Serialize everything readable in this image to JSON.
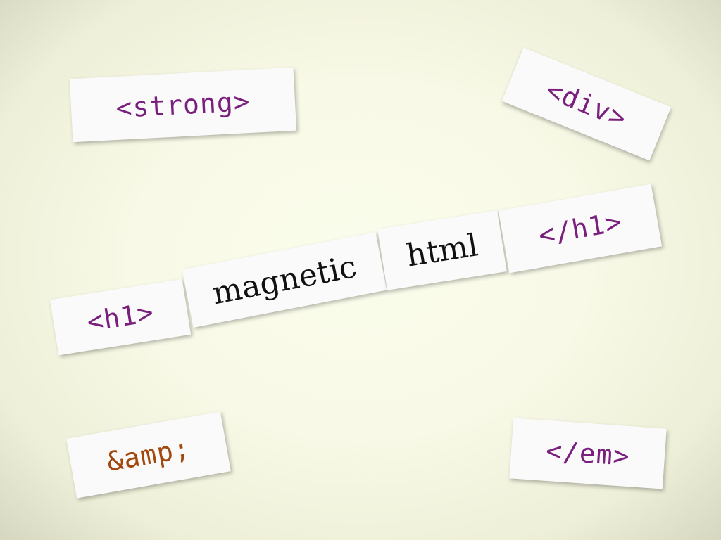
{
  "colors": {
    "tag": "#7a1f7d",
    "entity": "#a3480c",
    "word": "#111111",
    "magnet_face": "#fafafa",
    "board": "#f8f9e6"
  },
  "magnets": {
    "strong": "<strong>",
    "div": "<div>",
    "h1_open": "<h1>",
    "magnetic": "magnetic",
    "html": "html",
    "h1_close": "</h1>",
    "amp": "&amp;",
    "em_close": "</em>"
  }
}
